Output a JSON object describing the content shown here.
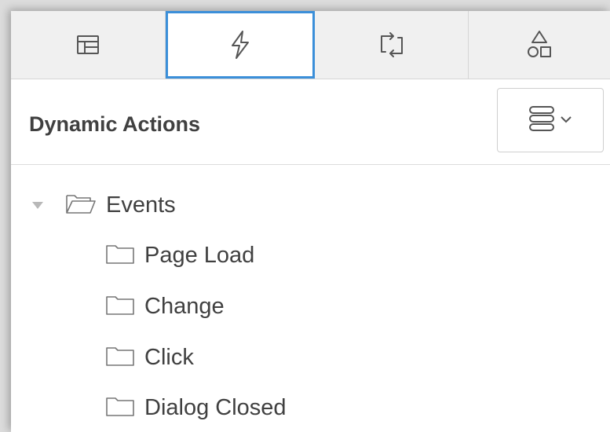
{
  "tabs": [
    {
      "icon": "layout-icon",
      "active": false
    },
    {
      "icon": "lightning-icon",
      "active": true
    },
    {
      "icon": "swap-icon",
      "active": false
    },
    {
      "icon": "shapes-icon",
      "active": false
    }
  ],
  "panel": {
    "title": "Dynamic Actions",
    "menu_icon": "stacked-menu-icon"
  },
  "tree": {
    "root": {
      "label": "Events",
      "expanded": true,
      "icon": "folder-open-icon"
    },
    "children": [
      {
        "label": "Page Load",
        "icon": "folder-icon"
      },
      {
        "label": "Change",
        "icon": "folder-icon"
      },
      {
        "label": "Click",
        "icon": "folder-icon"
      },
      {
        "label": "Dialog Closed",
        "icon": "folder-icon"
      }
    ]
  },
  "colors": {
    "accent": "#3b8fd9",
    "text": "#404040",
    "icon": "#555555"
  }
}
